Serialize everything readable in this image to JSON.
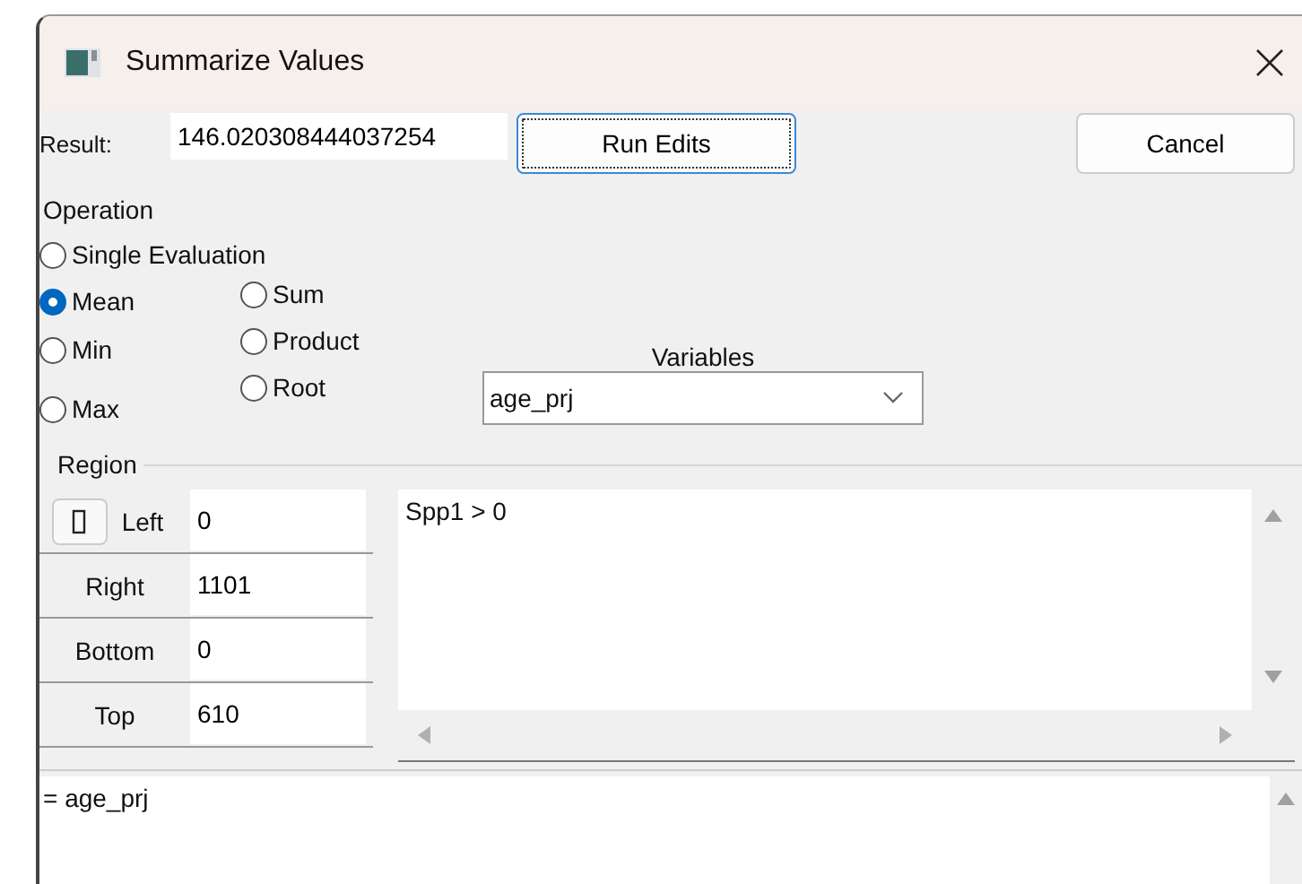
{
  "window": {
    "title": "Summarize Values"
  },
  "result": {
    "label": "Result:",
    "value": "146.020308444037254"
  },
  "buttons": [
    {
      "label": "Run Edits",
      "focused": true
    },
    {
      "label": "Cancel",
      "focused": false
    }
  ],
  "operation": {
    "label": "Operation",
    "options": [
      {
        "label": "Single Evaluation",
        "selected": false
      },
      {
        "label": "Mean",
        "selected": true
      },
      {
        "label": "Min",
        "selected": false
      },
      {
        "label": "Max",
        "selected": false
      },
      {
        "label": "Sum",
        "selected": false
      },
      {
        "label": "Product",
        "selected": false
      },
      {
        "label": "Root",
        "selected": false
      }
    ]
  },
  "variables": {
    "label": "Variables",
    "value": "age_prj"
  },
  "region": {
    "label": "Region",
    "fields": [
      {
        "label": "Left",
        "value": "0"
      },
      {
        "label": "Right",
        "value": "1101"
      },
      {
        "label": "Bottom",
        "value": "0"
      },
      {
        "label": "Top",
        "value": "610"
      }
    ]
  },
  "expression": "Spp1 > 0",
  "output": "= age_prj"
}
